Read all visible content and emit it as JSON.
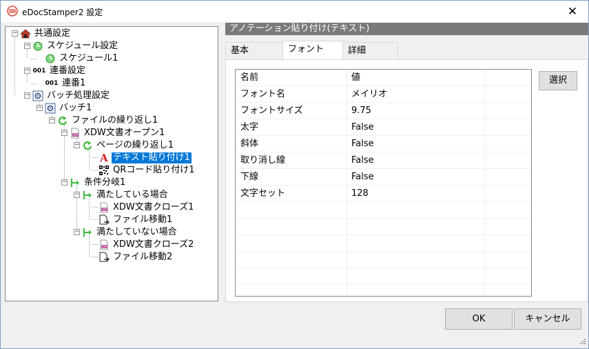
{
  "window": {
    "title": "eDocStamper2 設定",
    "close_glyph": "✕"
  },
  "tree": {
    "nodes": [
      {
        "label": "共通設定",
        "icon": "house-icon"
      },
      {
        "label": "スケジュール設定",
        "icon": "clock-icon"
      },
      {
        "label": "スケジュール1",
        "icon": "clock-icon"
      },
      {
        "label": "連番設定",
        "icon": "number-001-icon"
      },
      {
        "label": "連番1",
        "icon": "number-001-icon"
      },
      {
        "label": "バッチ処理設定",
        "icon": "batch-gear-icon"
      },
      {
        "label": "バッチ1",
        "icon": "batch-gear-icon"
      },
      {
        "label": "ファイルの繰り返し1",
        "icon": "loop-icon"
      },
      {
        "label": "XDW文書オープン1",
        "icon": "xdw-document-icon"
      },
      {
        "label": "ページの繰り返し1",
        "icon": "loop-icon"
      },
      {
        "label": "テキスト貼り付け1",
        "icon": "text-a-icon"
      },
      {
        "label": "QRコード貼り付け1",
        "icon": "qr-code-icon"
      },
      {
        "label": "条件分岐1",
        "icon": "branch-icon"
      },
      {
        "label": "満たしている場合",
        "icon": "branch-icon"
      },
      {
        "label": "XDW文書クローズ1",
        "icon": "xdw-document-icon"
      },
      {
        "label": "ファイル移動1",
        "icon": "file-move-icon"
      },
      {
        "label": "満たしていない場合",
        "icon": "branch-icon"
      },
      {
        "label": "XDW文書クローズ2",
        "icon": "xdw-document-icon"
      },
      {
        "label": "ファイル移動2",
        "icon": "file-move-icon"
      }
    ]
  },
  "panel": {
    "header": "アノテーション貼り付け(テキスト)",
    "tabs": [
      "基本",
      "フォント",
      "詳細"
    ],
    "active_tab": "フォント",
    "grid": {
      "headers": [
        "名前",
        "値"
      ],
      "rows": [
        [
          "フォント名",
          "メイリオ"
        ],
        [
          "フォントサイズ",
          "9.75"
        ],
        [
          "太字",
          "False"
        ],
        [
          "斜体",
          "False"
        ],
        [
          "取り消し線",
          "False"
        ],
        [
          "下線",
          "False"
        ],
        [
          "文字セット",
          "128"
        ]
      ]
    },
    "select_label": "選択"
  },
  "footer": {
    "ok_label": "OK",
    "cancel_label": "キャンセル"
  },
  "colors": {
    "selection": "#0078d7",
    "header_bg": "#7a7a7a",
    "icon_green": "#3cb93c",
    "icon_red": "#d42020"
  }
}
